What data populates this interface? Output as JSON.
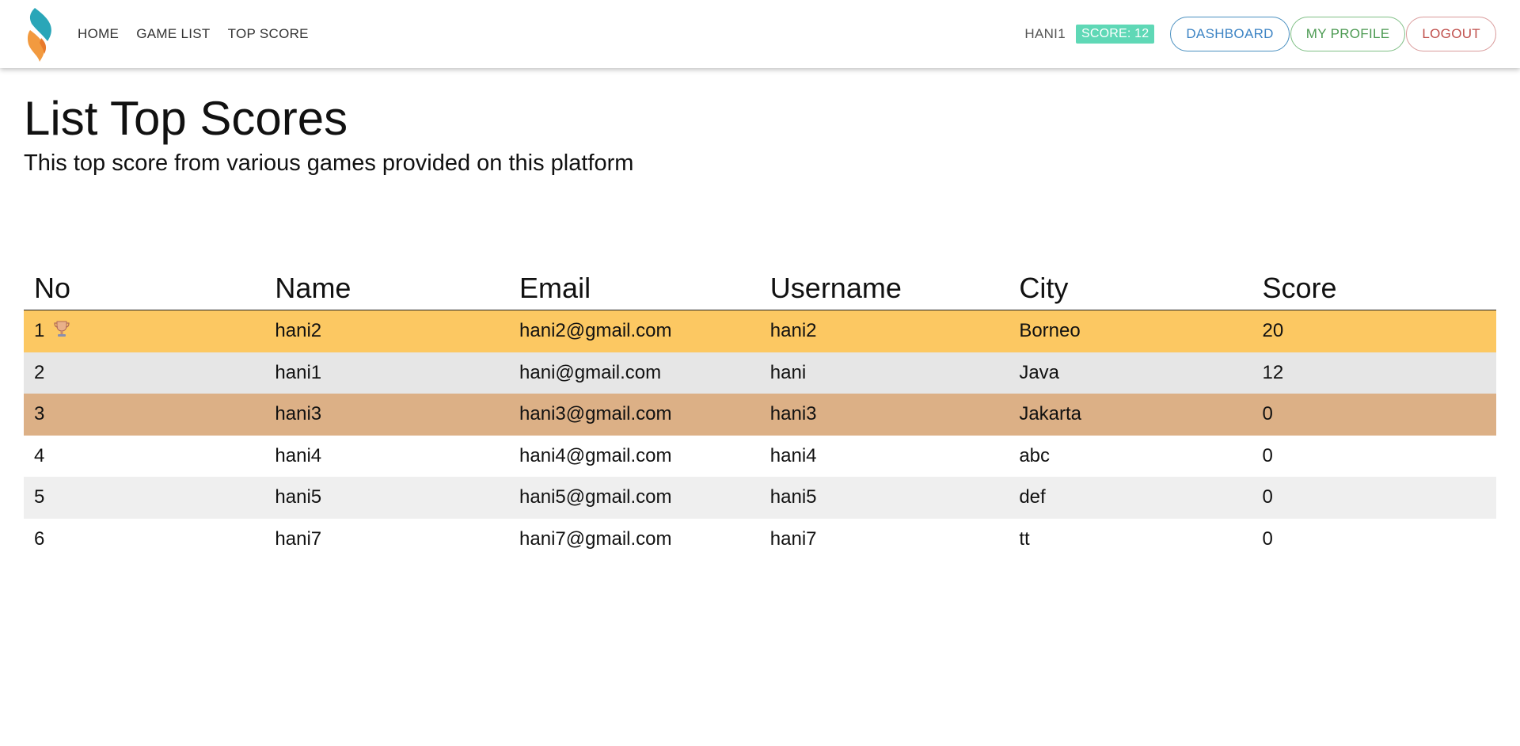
{
  "nav": {
    "links": [
      "HOME",
      "GAME LIST",
      "TOP SCORE"
    ],
    "username": "HANI1",
    "score_badge": "SCORE: 12",
    "buttons": {
      "dashboard": "DASHBOARD",
      "profile": "MY PROFILE",
      "logout": "LOGOUT"
    }
  },
  "page": {
    "title": "List Top Scores",
    "subtitle": "This top score from various games provided on this platform"
  },
  "table": {
    "headers": [
      "No",
      "Name",
      "Email",
      "Username",
      "City",
      "Score"
    ],
    "rows": [
      [
        "1",
        "hani2",
        "hani2@gmail.com",
        "hani2",
        "Borneo",
        "20"
      ],
      [
        "2",
        "hani1",
        "hani@gmail.com",
        "hani",
        "Java",
        "12"
      ],
      [
        "3",
        "hani3",
        "hani3@gmail.com",
        "hani3",
        "Jakarta",
        "0"
      ],
      [
        "4",
        "hani4",
        "hani4@gmail.com",
        "hani4",
        "abc",
        "0"
      ],
      [
        "5",
        "hani5",
        "hani5@gmail.com",
        "hani5",
        "def",
        "0"
      ],
      [
        "6",
        "hani7",
        "hani7@gmail.com",
        "hani7",
        "tt",
        "0"
      ]
    ]
  },
  "colors": {
    "gold_row": "#fcc862",
    "silver_row": "#e6e6e6",
    "bronze_row": "#dcb086",
    "score_badge": "#5fd8b6"
  },
  "icons": {
    "logo": "flame-logo-icon",
    "rank1": "trophy-icon"
  }
}
